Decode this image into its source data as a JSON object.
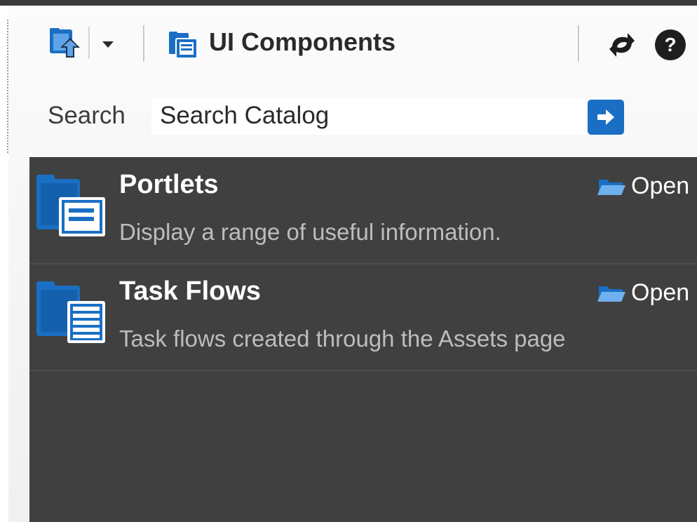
{
  "toolbar": {
    "up_icon": "folder-up-icon",
    "dropdown_icon": "chevron-down-icon",
    "catalog_icon": "catalog-icon",
    "breadcrumb_label": "UI Components",
    "refresh_icon": "refresh-icon",
    "help_icon": "help-icon"
  },
  "search": {
    "label": "Search",
    "value": "Search Catalog",
    "go_icon": "arrow-right-icon"
  },
  "items": [
    {
      "title": "Portlets",
      "description": "Display a range of useful information.",
      "open_label": "Open",
      "icon": "portlets-folder-icon"
    },
    {
      "title": "Task Flows",
      "description": "Task flows created through the Assets page",
      "open_label": "Open",
      "icon": "task-flows-folder-icon"
    }
  ],
  "colors": {
    "accent_blue": "#1a6fc4",
    "list_background": "#404040",
    "title_text": "#ffffff",
    "description_text": "#bdbdbd"
  }
}
